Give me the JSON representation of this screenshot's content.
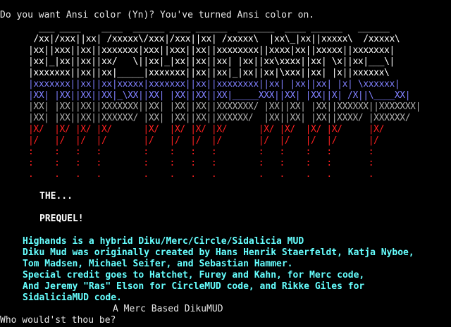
{
  "terminal": {
    "prompt_ansi": "Do you want Ansi color (Yn)? You've turned Ansi color on.",
    "banner_art": {
      "lines": [
        {
          "text": "  ___ ____    ____  ______ ____ ______  _______  ____ ______   ______",
          "color": "#ffffff"
        },
        {
          "text": " /xx|/xxx||xx| /xxxxx\\/xxx|/xxx||xx| /xxxxx\\  |xx\\_|xx||xxxxx\\  /xxxxx\\",
          "color": "#ffffff"
        },
        {
          "text": "|xx||xxx||xx||xxxxxxx|xxx||xxx||xx||xxxxxxxx||xxxx|xx||xxxxx||xxxxxxx|",
          "color": "#ffffff"
        },
        {
          "text": "|xx|_|xx||xx||xx/   \\||xx|_|xx||xx||xx| |xx||xx\\xxxx||xx| \\x||xx|___\\|",
          "color": "#ffffff"
        },
        {
          "text": "|xxxxxxx||xx||xx|_____|xxxxxxx||xx||xx|_|xx||xx|\\xxx||xx| |x||xxxxxx\\",
          "color": "#ffffff"
        },
        {
          "text": "|xxxxxxx||xx||xx|xxxxx|xxxxxxx||xx||xxxxxxxx||xx| |xx||xx| |x| \\xxxxxx|",
          "color": "#8080ff"
        },
        {
          "text": "|XX| |XX||XX||XX|_\\XX||XX| |XX||XX||XX|_____XXX||XX| |XX||X| /X||\\____XX|",
          "color": "#8080ff"
        },
        {
          "text": "|XX| |XX||XX||XXXXXXX||XX| |XX||XX||XXXXXXX/ |XX||XX| |XX||XXXXXX||XXXXXXX|",
          "color": "#b0b0b0"
        },
        {
          "text": "|XX| |XX||XX||XXXXXX/ |XX| |XX||XX||XXXXXX/  |XX||XX| |XX||XXXX/ |XXXXXX/",
          "color": "#b0b0b0"
        },
        {
          "text": "|X/  |X/ |X/ |X/      |X/  |X/ |X/ |X/      |X/ |X/  |X/ |X/     |X/",
          "color": "#ff2020"
        },
        {
          "text": "|/   |/  |/  |/       |/   |/  |/  |/       |/  |/   |/  |/      |/",
          "color": "#ff2020"
        },
        {
          "text": ":    :   :   :        :    :   :   :        :   :    :   :       :",
          "color": "#ff2020"
        },
        {
          "text": ":    :   :   :        :    :   :   :        :   :    :   :       :",
          "color": "#ff2020"
        },
        {
          "text": ".    .   .   .        .    .   .   .        .   .    .   .       .",
          "color": "#ff2020"
        }
      ]
    },
    "subtitle_line1": "THE...",
    "subtitle_line2": "PREQUEL!",
    "info_lines": [
      "Highands is a hybrid Diku/Merc/Circle/Sidalicia MUD",
      "Diku Mud was originally created by Hans Henrik Staerfeldt, Katja Nyboe,",
      "Tom Madsen, Michael Seifer, and Sebastian Hammer.",
      "Special credit goes to Hatchet, Furey and Kahn, for Merc code,",
      "And Jeremy \"Ras\" Elson for CircleMUD code, and Rikke Giles for",
      "SidaliciaMUD code."
    ],
    "merc_line": "A Merc Based DikuMUD",
    "login_prompt": "Who would'st thou be?",
    "colors": {
      "background": "#000000",
      "text": "#e8e8e8",
      "info": "#66ffff"
    }
  }
}
